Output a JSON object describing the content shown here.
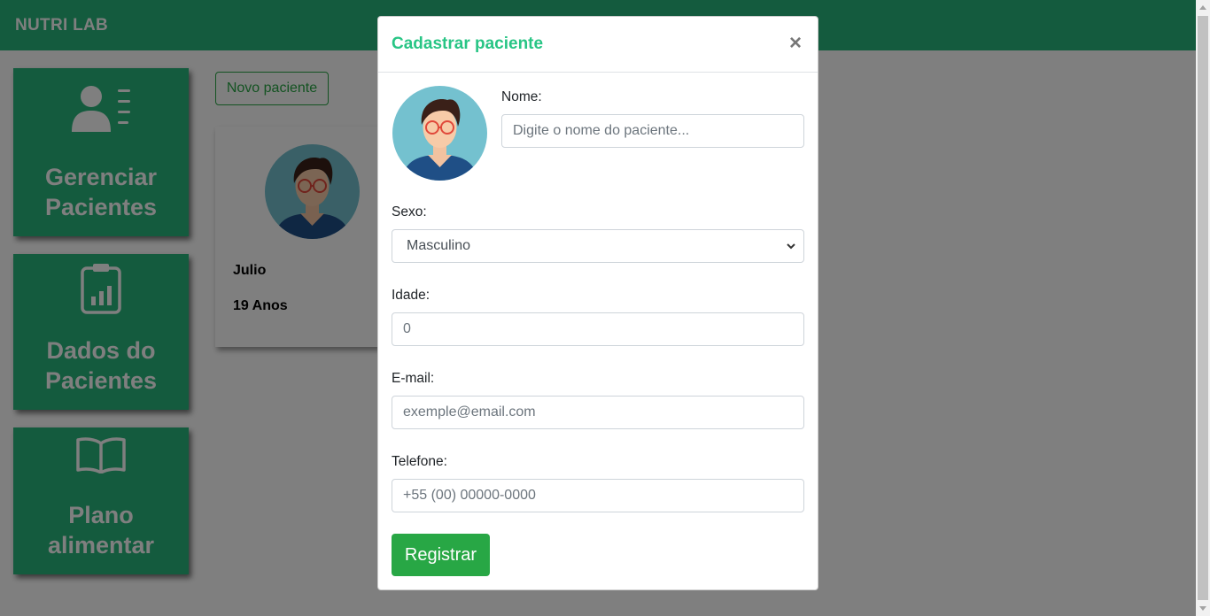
{
  "navbar": {
    "brand": "NUTRI LAB"
  },
  "sidebar": {
    "items": [
      {
        "label_line1": "Gerenciar",
        "label_line2": "Pacientes",
        "icon": "user-list-icon"
      },
      {
        "label_line1": "Dados do",
        "label_line2": "Pacientes",
        "icon": "clipboard-chart-icon"
      },
      {
        "label_line1": "Plano",
        "label_line2": "alimentar",
        "icon": "open-book-icon"
      }
    ]
  },
  "main": {
    "new_patient_button": "Novo paciente",
    "patients": [
      {
        "name": "Julio",
        "age": "19 Anos"
      }
    ]
  },
  "modal": {
    "title": "Cadastrar paciente",
    "close": "×",
    "fields": {
      "name_label": "Nome:",
      "name_placeholder": "Digite o nome do paciente...",
      "sex_label": "Sexo:",
      "sex_value": "Masculino",
      "age_label": "Idade:",
      "age_placeholder": "0",
      "email_label": "E-mail:",
      "email_placeholder": "exemple@email.com",
      "phone_label": "Telefone:",
      "phone_placeholder": "+55 (00) 00000-0000"
    },
    "register_button": "Registrar"
  },
  "colors": {
    "brand_green": "#28b67c",
    "button_green": "#28a745",
    "title_green": "#28c585"
  }
}
